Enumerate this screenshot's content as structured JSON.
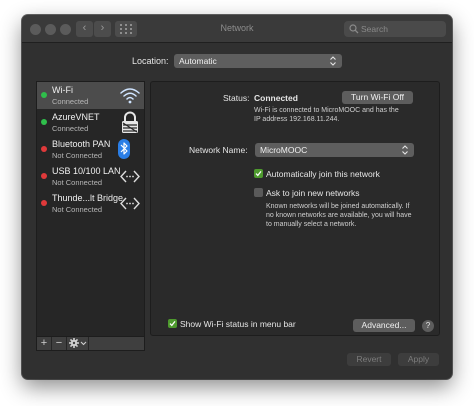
{
  "window": {
    "title": "Network",
    "search_placeholder": "Search"
  },
  "location": {
    "label": "Location:",
    "value": "Automatic"
  },
  "services": [
    {
      "name": "Wi-Fi",
      "status": "Connected",
      "status_color": "#2fbf4b",
      "icon": "wifi-icon"
    },
    {
      "name": "AzureVNET",
      "status": "Connected",
      "status_color": "#2fbf4b",
      "icon": "vpn-lock-icon"
    },
    {
      "name": "Bluetooth PAN",
      "status": "Not Connected",
      "status_color": "#e0393a",
      "icon": "bluetooth-icon"
    },
    {
      "name": "USB 10/100 LAN",
      "status": "Not Connected",
      "status_color": "#e0393a",
      "icon": "ethernet-icon"
    },
    {
      "name": "Thunde...lt Bridge",
      "status": "Not Connected",
      "status_color": "#e0393a",
      "icon": "ethernet-icon"
    }
  ],
  "list_controls": {
    "add": "+",
    "remove": "−"
  },
  "detail": {
    "status_label": "Status:",
    "status_value": "Connected",
    "turn_off_button": "Turn Wi-Fi Off",
    "status_desc_line1": "Wi-Fi is connected to MicroMOOC and has the",
    "status_desc_line2": "IP address 192.168.11.244.",
    "network_name_label": "Network Name:",
    "network_name_value": "MicroMOOC",
    "auto_join_label": "Automatically join this network",
    "auto_join_checked": true,
    "ask_join_label": "Ask to join new networks",
    "ask_join_checked": false,
    "ask_desc_line1": "Known networks will be joined automatically. If",
    "ask_desc_line2": "no known networks are available, you will have",
    "ask_desc_line3": "to manually select a network.",
    "show_status_label": "Show Wi-Fi status in menu bar",
    "show_status_checked": true,
    "advanced_button": "Advanced...",
    "help_button": "?"
  },
  "footer": {
    "revert_button": "Revert",
    "apply_button": "Apply"
  },
  "colors": {
    "accent_check": "#4e9a2e",
    "connected": "#2fbf4b",
    "not_connected": "#e0393a"
  }
}
